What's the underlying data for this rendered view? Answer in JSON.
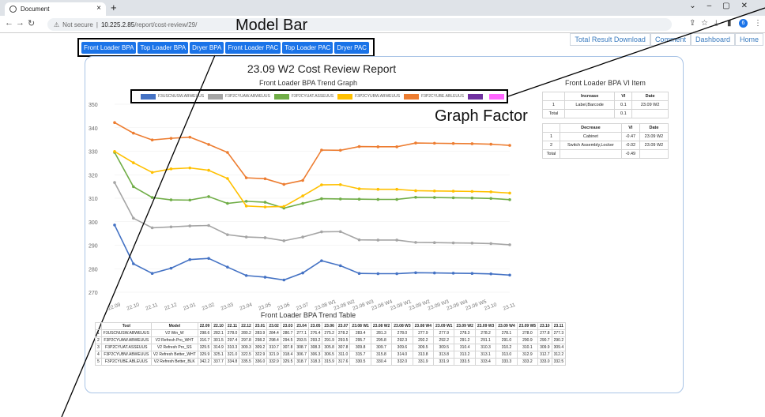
{
  "browser": {
    "tab_title": "Document",
    "url_prefix": "Not secure",
    "url_host": "10.225.2.85",
    "url_path": "/report/cost-review/29/",
    "profile_initial": "6"
  },
  "top_links": [
    "Total Result Download",
    "Comment",
    "Dashboard",
    "Home"
  ],
  "model_tabs": [
    "Front Loader BPA",
    "Top Loader BPA",
    "Dryer BPA",
    "Front Loader PAC",
    "Top Loader PAC",
    "Dryer PAC"
  ],
  "annotations": {
    "model_bar": "Model Bar",
    "graph_factor": "Graph Factor"
  },
  "report_title": "23.09 W2 Cost Review Report",
  "graph_title": "Front Loader BPA Trend Graph",
  "table_title": "Front Loader BPA Trend Table",
  "vi_title": "Front Loader BPA VI Item",
  "colors": {
    "s1": "#4472c4",
    "s2": "#a5a5a5",
    "s3": "#70ad47",
    "s4": "#ffc000",
    "s5": "#ed7d31",
    "s6": "#7030a0",
    "s7": "#ff66ff"
  },
  "chart_data": {
    "type": "line",
    "title": "Front Loader BPA Trend Graph",
    "x": [
      "22.09",
      "22.10",
      "22.11",
      "22.12",
      "23.01",
      "23.02",
      "23.03",
      "23.04",
      "23.05",
      "23.06",
      "23.07",
      "23.08 W1",
      "23.08 W2",
      "23.08 W3",
      "23.08 W4",
      "23.09 W1",
      "23.09 W2",
      "23.09 W3",
      "23.09 W4",
      "23.09 W5",
      "23.10",
      "23.11"
    ],
    "ylim": [
      270,
      350
    ],
    "yticks": [
      270,
      280,
      290,
      300,
      310,
      320,
      330,
      340,
      350
    ],
    "series": [
      {
        "name": "F3USCNUSW.ABWEUUS",
        "color": "#4472c4",
        "values": [
          298.6,
          282.1,
          278.0,
          280.2,
          283.9,
          284.4,
          280.7,
          277.1,
          276.4,
          275.2,
          278.2,
          283.4,
          281.3,
          278.0,
          277.9,
          277.9,
          278.3,
          278.2,
          278.1,
          278.0,
          277.8,
          277.3
        ]
      },
      {
        "name": "F3P2CYUAW.ABWEUUS",
        "color": "#a5a5a5",
        "values": [
          316.7,
          301.5,
          297.4,
          297.8,
          298.2,
          298.4,
          294.5,
          293.5,
          293.2,
          291.9,
          293.5,
          295.7,
          295.8,
          292.3,
          292.2,
          292.2,
          291.2,
          291.1,
          291.0,
          290.9,
          290.7,
          290.2
        ]
      },
      {
        "name": "F3P2CYUAT.ASSEUUS",
        "color": "#70ad47",
        "values": [
          329.5,
          314.9,
          310.3,
          309.3,
          309.2,
          310.7,
          307.8,
          308.7,
          308.3,
          305.8,
          307.8,
          309.8,
          309.7,
          309.6,
          309.5,
          309.5,
          310.4,
          310.3,
          310.2,
          310.1,
          309.9,
          309.4
        ]
      },
      {
        "name": "F3P2CYUBW.ABWEUUS",
        "color": "#ffc000",
        "values": [
          329.9,
          325.1,
          321.0,
          322.5,
          322.9,
          321.9,
          318.4,
          306.7,
          306.3,
          306.5,
          311.0,
          315.7,
          315.8,
          314.0,
          313.8,
          313.8,
          313.2,
          313.1,
          313.0,
          312.9,
          312.7,
          312.2
        ]
      },
      {
        "name": "F3P2CYUBE.ABLEUUS",
        "color": "#ed7d31",
        "values": [
          342.2,
          337.7,
          334.8,
          335.5,
          336.0,
          332.9,
          329.5,
          318.7,
          318.3,
          315.9,
          317.6,
          330.5,
          330.4,
          332.0,
          331.9,
          331.9,
          333.5,
          333.4,
          333.3,
          333.2,
          333.0,
          332.5
        ]
      },
      {
        "name": "",
        "color": "#7030a0",
        "values": []
      },
      {
        "name": "",
        "color": "#ff66ff",
        "values": []
      }
    ]
  },
  "trend_table": {
    "headers": [
      "",
      "Tool",
      "Model",
      "22.09",
      "22.10",
      "22.11",
      "22.12",
      "23.01",
      "23.02",
      "23.03",
      "23.04",
      "23.05",
      "23.06",
      "23.07",
      "23.08 W1",
      "23.08 W2",
      "23.08 W3",
      "23.08 W4",
      "23.09 W1",
      "23.09 W2",
      "23.09 W3",
      "23.09 W4",
      "23.09 W5",
      "23.10",
      "23.11"
    ],
    "rows": [
      [
        "1",
        "F3USCNUSW.ABWEUUS",
        "V2 Win_W",
        "298.6",
        "282.1",
        "278.0",
        "280.2",
        "283.9",
        "284.4",
        "280.7",
        "277.1",
        "276.4",
        "275.2",
        "278.2",
        "283.4",
        "281.3",
        "278.0",
        "277.9",
        "277.9",
        "278.3",
        "278.2",
        "278.1",
        "278.0",
        "277.8",
        "277.3"
      ],
      [
        "2",
        "F3P2CYUAW.ABWEUUS",
        "V2 Refresh Pro_WHT",
        "316.7",
        "301.5",
        "297.4",
        "297.8",
        "298.2",
        "298.4",
        "294.5",
        "293.5",
        "293.2",
        "291.9",
        "293.5",
        "295.7",
        "295.8",
        "292.3",
        "292.2",
        "292.2",
        "291.2",
        "291.1",
        "291.0",
        "290.9",
        "290.7",
        "290.2"
      ],
      [
        "3",
        "F3P2CYUAT.ASSEUUS",
        "V2 Refresh Pro_SS",
        "329.5",
        "314.9",
        "310.3",
        "309.3",
        "309.2",
        "310.7",
        "307.8",
        "308.7",
        "308.3",
        "305.8",
        "307.8",
        "309.8",
        "309.7",
        "309.6",
        "309.5",
        "309.5",
        "310.4",
        "310.3",
        "310.2",
        "310.1",
        "309.9",
        "309.4"
      ],
      [
        "4",
        "F3P2CYUBW.ABWEUUS",
        "V2 Refresh Better_WHT",
        "329.9",
        "325.1",
        "321.0",
        "322.5",
        "322.9",
        "321.9",
        "318.4",
        "306.7",
        "306.3",
        "306.5",
        "311.0",
        "315.7",
        "315.8",
        "314.0",
        "313.8",
        "313.8",
        "313.2",
        "313.1",
        "313.0",
        "312.9",
        "312.7",
        "312.2"
      ],
      [
        "5",
        "F3P2CYUBE.ABLEUUS",
        "V2 Refresh Better_BLK",
        "342.2",
        "337.7",
        "334.8",
        "335.5",
        "336.0",
        "332.9",
        "329.5",
        "318.7",
        "318.3",
        "315.9",
        "317.6",
        "330.5",
        "330.4",
        "332.0",
        "331.9",
        "331.9",
        "333.5",
        "333.4",
        "333.3",
        "333.2",
        "333.0",
        "332.5"
      ]
    ]
  },
  "vi_increase": {
    "headers": [
      "",
      "Increase",
      "VI",
      "Date"
    ],
    "rows": [
      [
        "1",
        "Label,Barcode",
        "0.1",
        "23.09 W2"
      ]
    ],
    "total": [
      "Total",
      "",
      "0.1",
      ""
    ]
  },
  "vi_decrease": {
    "headers": [
      "",
      "Decrease",
      "VI",
      "Date"
    ],
    "rows": [
      [
        "1",
        "Cabinet",
        "-0.47",
        "23.09 W2"
      ],
      [
        "2",
        "Switch Assembly,Locker",
        "-0.02",
        "23.09 W2"
      ]
    ],
    "total": [
      "Total",
      "",
      "-0.49",
      ""
    ]
  }
}
